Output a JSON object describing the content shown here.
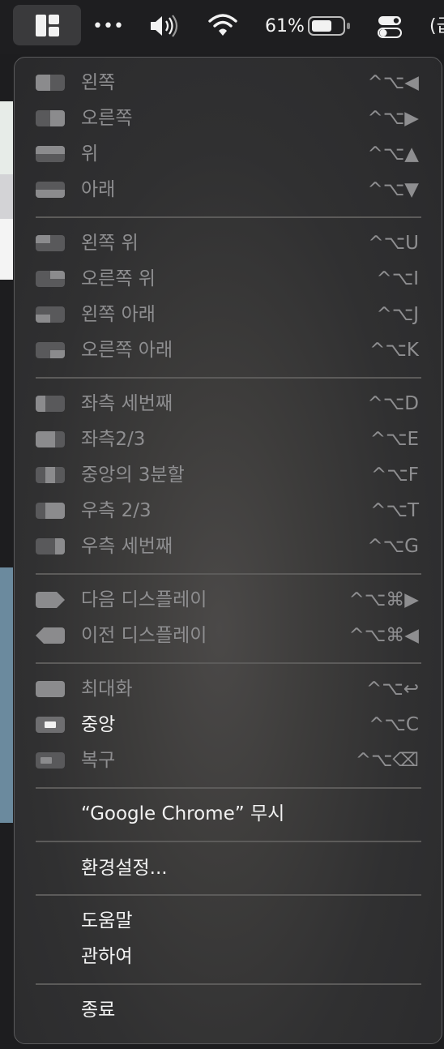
{
  "menubar": {
    "more": "•••",
    "battery_pct": "61%",
    "clipped_text": "(급"
  },
  "menu": {
    "group1": [
      {
        "label": "왼쪽",
        "keys": "^⌥◀"
      },
      {
        "label": "오른쪽",
        "keys": "^⌥▶"
      },
      {
        "label": "위",
        "keys": "^⌥▲"
      },
      {
        "label": "아래",
        "keys": "^⌥▼"
      }
    ],
    "group2": [
      {
        "label": "왼쪽 위",
        "keys": "^⌥U"
      },
      {
        "label": "오른쪽 위",
        "keys": "^⌥I"
      },
      {
        "label": "왼쪽 아래",
        "keys": "^⌥J"
      },
      {
        "label": "오른쪽 아래",
        "keys": "^⌥K"
      }
    ],
    "group3": [
      {
        "label": "좌측 세번째",
        "keys": "^⌥D"
      },
      {
        "label": "좌측2/3",
        "keys": "^⌥E"
      },
      {
        "label": "중앙의 3분할",
        "keys": "^⌥F"
      },
      {
        "label": "우측 2/3",
        "keys": "^⌥T"
      },
      {
        "label": "우측 세번째",
        "keys": "^⌥G"
      }
    ],
    "group4": [
      {
        "label": "다음 디스플레이",
        "keys": "^⌥⌘▶"
      },
      {
        "label": "이전 디스플레이",
        "keys": "^⌥⌘◀"
      }
    ],
    "group5": [
      {
        "label": "최대화",
        "keys": "^⌥↩"
      },
      {
        "label": "중앙",
        "keys": "^⌥C"
      },
      {
        "label": "복구",
        "keys": "^⌥⌫"
      }
    ],
    "ignore_app": "“Google Chrome” 무시",
    "preferences": "환경설정...",
    "help": "도움말",
    "about": "관하여",
    "quit": "종료"
  },
  "colors": {
    "menu_text_dim": "#8e8e90",
    "menu_text_bright": "#f2f2f2",
    "menubar_bg": "#1e1e20"
  }
}
